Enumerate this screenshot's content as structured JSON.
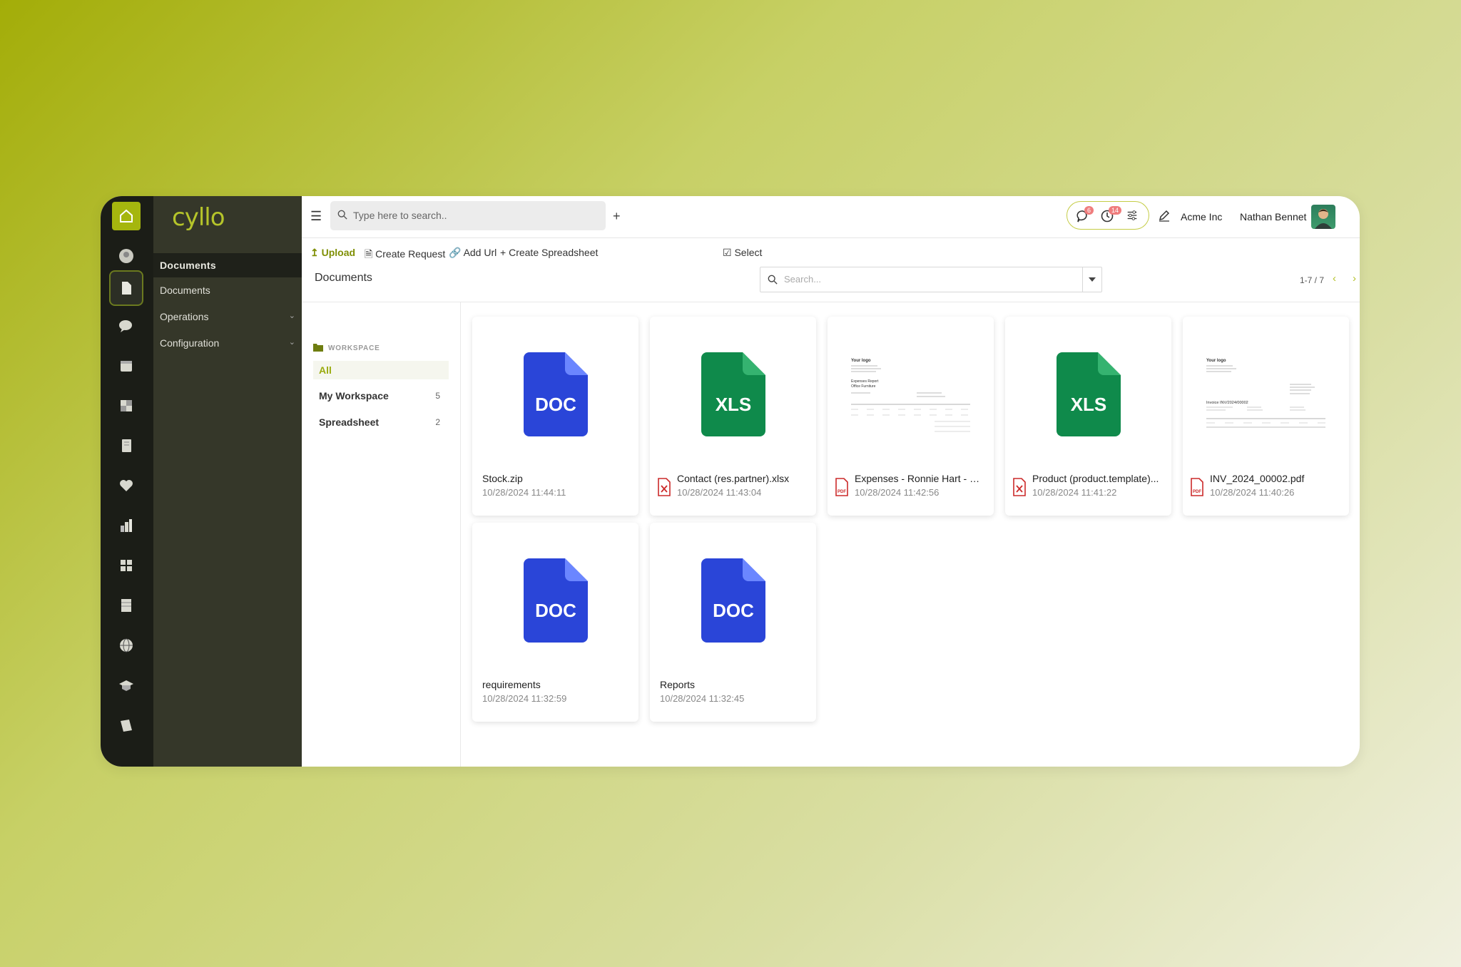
{
  "app": {
    "logo": "cyllo",
    "menu_header": "Documents",
    "menu_items": [
      {
        "label": "Documents"
      },
      {
        "label": "Operations"
      },
      {
        "label": "Configuration"
      }
    ]
  },
  "rail_icons": [
    "home-icon",
    "user-circle-icon",
    "document-icon",
    "chat-icon",
    "calendar-icon",
    "puzzle-icon",
    "notebook-icon",
    "heart-icon",
    "chart-icon",
    "grid-icon",
    "ledger-icon",
    "globe-icon",
    "graduation-icon",
    "cards-icon"
  ],
  "topbar": {
    "search_placeholder": "Type here to search..",
    "messages_badge": "6",
    "activities_badge": "14",
    "company": "Acme Inc",
    "user": "Nathan Bennet"
  },
  "actions": {
    "upload": "Upload",
    "create_request": "Create Request",
    "add_url": "Add Url",
    "create_spreadsheet": "Create Spreadsheet",
    "select": "Select"
  },
  "control": {
    "title": "Documents",
    "search_placeholder": "Search...",
    "pager": "1-7 / 7"
  },
  "folders": {
    "section": "WORKSPACE",
    "items": [
      {
        "label": "All",
        "count": ""
      },
      {
        "label": "My Workspace",
        "count": "5"
      },
      {
        "label": "Spreadsheet",
        "count": "2"
      }
    ]
  },
  "documents": [
    {
      "name": "Stock.zip",
      "date": "10/28/2024 11:44:11",
      "thumb": "DOC"
    },
    {
      "name": "Contact (res.partner).xlsx",
      "date": "10/28/2024 11:43:04",
      "thumb": "XLS"
    },
    {
      "name": "Expenses - Ronnie Hart - O...",
      "date": "10/28/2024 11:42:56",
      "thumb": "preview"
    },
    {
      "name": "Product (product.template)...",
      "date": "10/28/2024 11:41:22",
      "thumb": "XLS"
    },
    {
      "name": "INV_2024_00002.pdf",
      "date": "10/28/2024 11:40:26",
      "thumb": "preview"
    },
    {
      "name": "requirements",
      "date": "10/28/2024 11:32:59",
      "thumb": "DOC"
    },
    {
      "name": "Reports",
      "date": "10/28/2024 11:32:45",
      "thumb": "DOC"
    }
  ],
  "previews": {
    "expense": {
      "logo": "Your logo",
      "title": "Expenses Report",
      "subtitle": "Office Furniture"
    },
    "invoice": {
      "logo": "Your logo",
      "title": "Invoice INV/2024/00002"
    }
  },
  "colors": {
    "accent": "#a5b60e",
    "doc": "#2a45d8",
    "xls": "#0f8a4b",
    "pdf": "#cc2a2a"
  }
}
